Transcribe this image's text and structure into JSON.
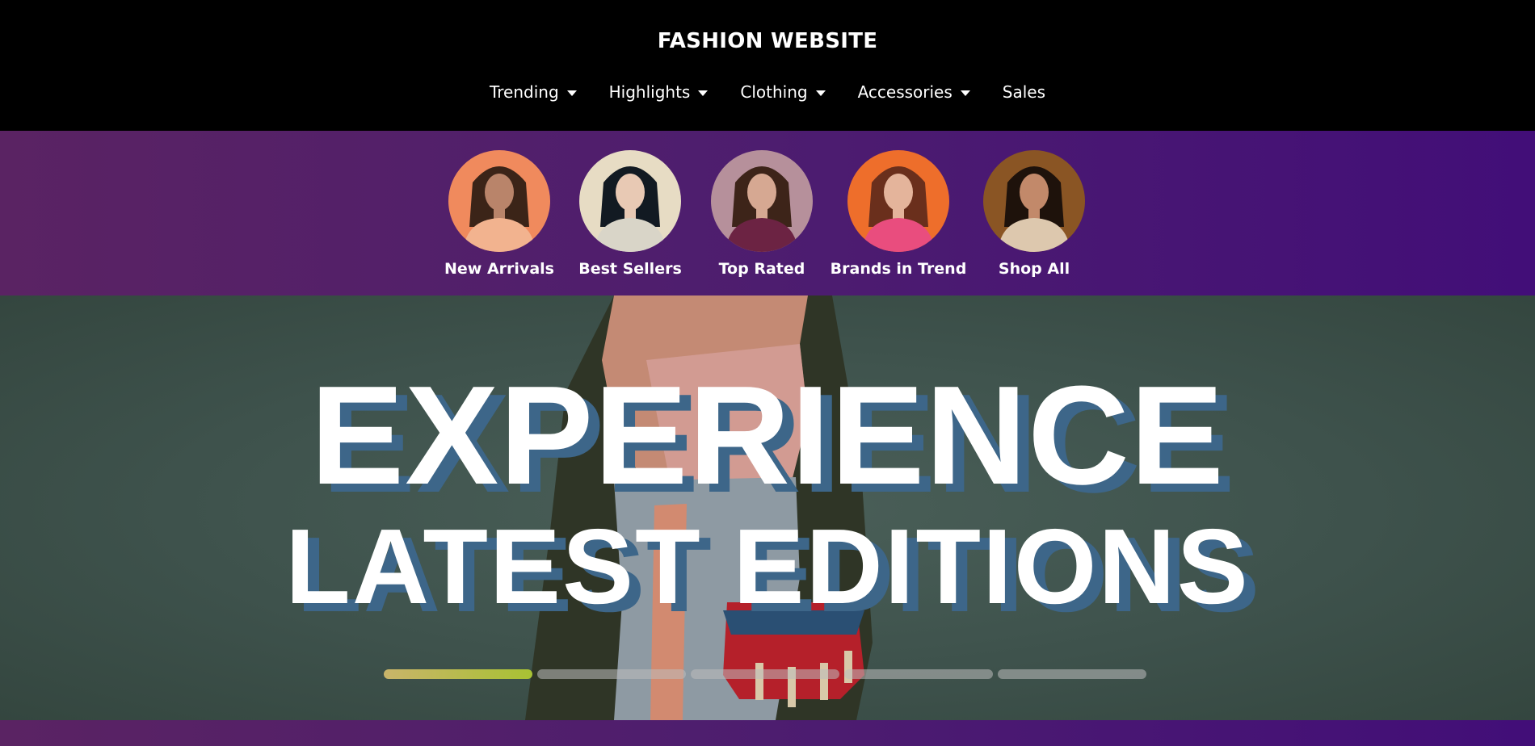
{
  "brand": "FASHION WEBSITE",
  "nav": [
    {
      "label": "Trending",
      "dropdown": true
    },
    {
      "label": "Highlights",
      "dropdown": true
    },
    {
      "label": "Clothing",
      "dropdown": true
    },
    {
      "label": "Accessories",
      "dropdown": true
    },
    {
      "label": "Sales",
      "dropdown": false
    }
  ],
  "categories": [
    {
      "label": "New Arrivals",
      "bg": "#f08a5d",
      "outfit": "#f2b38f",
      "hair": "#3b2418",
      "skin": "#b9846a"
    },
    {
      "label": "Best Sellers",
      "bg": "#e7dcc4",
      "outfit": "#d9d5c8",
      "hair": "#121a22",
      "skin": "#e8c9b4"
    },
    {
      "label": "Top Rated",
      "bg": "#b6909b",
      "outfit": "#6c2343",
      "hair": "#3d2419",
      "skin": "#d6a892"
    },
    {
      "label": "Brands in Trend",
      "bg": "#ee6e2b",
      "outfit": "#e94d7e",
      "hair": "#6a2f1c",
      "skin": "#e4b49b"
    },
    {
      "label": "Shop All",
      "bg": "#8a5524",
      "outfit": "#ddc8ae",
      "hair": "#1e120b",
      "skin": "#c2896a"
    }
  ],
  "hero": {
    "line1": "EXPERIENCE",
    "line2": "LATEST EDITIONS",
    "slide_count": 5,
    "active_slide": 1
  },
  "colors": {
    "header_bg": "#000000",
    "strip_start": "#5a2363",
    "strip_end": "#420e78",
    "hero_bg": "#3e524c",
    "text_shadow": "#3d6689"
  }
}
